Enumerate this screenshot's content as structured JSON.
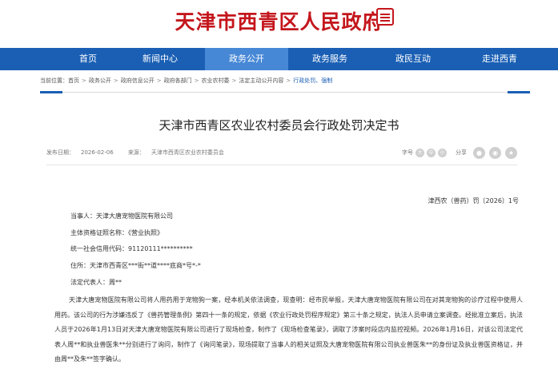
{
  "header": {
    "site_title": "天津市西青区人民政府"
  },
  "nav": {
    "items": [
      {
        "label": "首页"
      },
      {
        "label": "新闻中心"
      },
      {
        "label": "政务公开",
        "active": true
      },
      {
        "label": "政务服务"
      },
      {
        "label": "政民互动"
      },
      {
        "label": "走进西青"
      }
    ]
  },
  "breadcrumb": {
    "prefix": "当前位置：",
    "items": [
      "首页",
      "政务公开",
      "政府信息公开",
      "政府各部门",
      "农业农村委",
      "法定主动公开内容",
      "行政处罚、强制"
    ],
    "separator": ">"
  },
  "article": {
    "title": "天津市西青区农业农村委员会行政处罚决定书",
    "publish_date_label": "发布日期：",
    "publish_date": "2026-02-06",
    "source_label": "来源：",
    "source": "天津市西青区农业农村委员会",
    "font_size_label": "字号",
    "font_sizes": [
      "大",
      "中",
      "小"
    ],
    "share_label": "分享",
    "share_icons": [
      "wechat-icon",
      "weibo-icon",
      "favorite-icon"
    ],
    "doc_number": "津西农（兽药）罚〔2026〕1号",
    "fields": [
      "当事人：天津大唐宠物医院有限公司",
      "主体资格证照名称：《营业执照》",
      "统一社会信用代码：91120111**********",
      "住所：天津市西青区***街**道****底商*号*-*",
      "法定代表人：周**"
    ],
    "body": "天津大唐宠物医院有限公司将人用药用于宠物狗一案，经本机关依法调查，现查明：经市民举报，天津大唐宠物医院有限公司在对其宠物狗的诊疗过程中使用人用药。该公司的行为涉嫌违反了《兽药管理条例》第四十一条的规定，依据《农业行政处罚程序规定》第三十条之规定，执法人员申请立案调查。经批准立案后，执法人员于2026年1月13日对天津大唐宠物医院有限公司进行了现场检查，制作了《现场检查笔录》，调取了涉案时段店内监控视频。2026年1月16日，对该公司法定代表人周**和执业兽医朱**分别进行了询问，制作了《询问笔录》，现场提取了当事人的相关证照及大唐宠物医院有限公司执业兽医朱**的身份证及执业兽医资格证，并由周**及朱**签字确认。"
  },
  "colors": {
    "brand_red": "#c4161c",
    "nav_blue": "#1a5fb4",
    "nav_active": "#4788d6"
  }
}
